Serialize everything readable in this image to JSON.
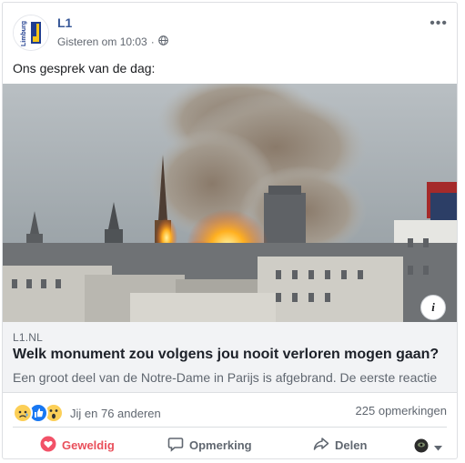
{
  "header": {
    "page_name": "L1",
    "logo_text": "Limburg",
    "timestamp": "Gisteren om 10:03",
    "separator": "·",
    "audience_icon": "globe-icon",
    "more_icon": "more-dots-icon",
    "more_label": "•••"
  },
  "post": {
    "text": "Ons gesprek van de dag:"
  },
  "link_preview": {
    "domain": "L1.NL",
    "title": "Welk monument zou volgens jou nooit verloren mogen gaan?",
    "description": "Een groot deel van de Notre-Dame in Parijs is afgebrand. De eerste reactie",
    "info_label": "i"
  },
  "reactions": {
    "icons": [
      "sad-reaction-icon",
      "like-reaction-icon",
      "wow-reaction-icon"
    ],
    "summary": "Jij en 76 anderen",
    "comments": "225 opmerkingen"
  },
  "actions": {
    "like": "Geweldig",
    "comment": "Opmerking",
    "share": "Delen"
  },
  "colors": {
    "name_link": "#385898",
    "liked": "#e9505b",
    "logo_blue": "#1f3d8f",
    "logo_yellow": "#f5c518",
    "like_blue": "#1877f2"
  }
}
